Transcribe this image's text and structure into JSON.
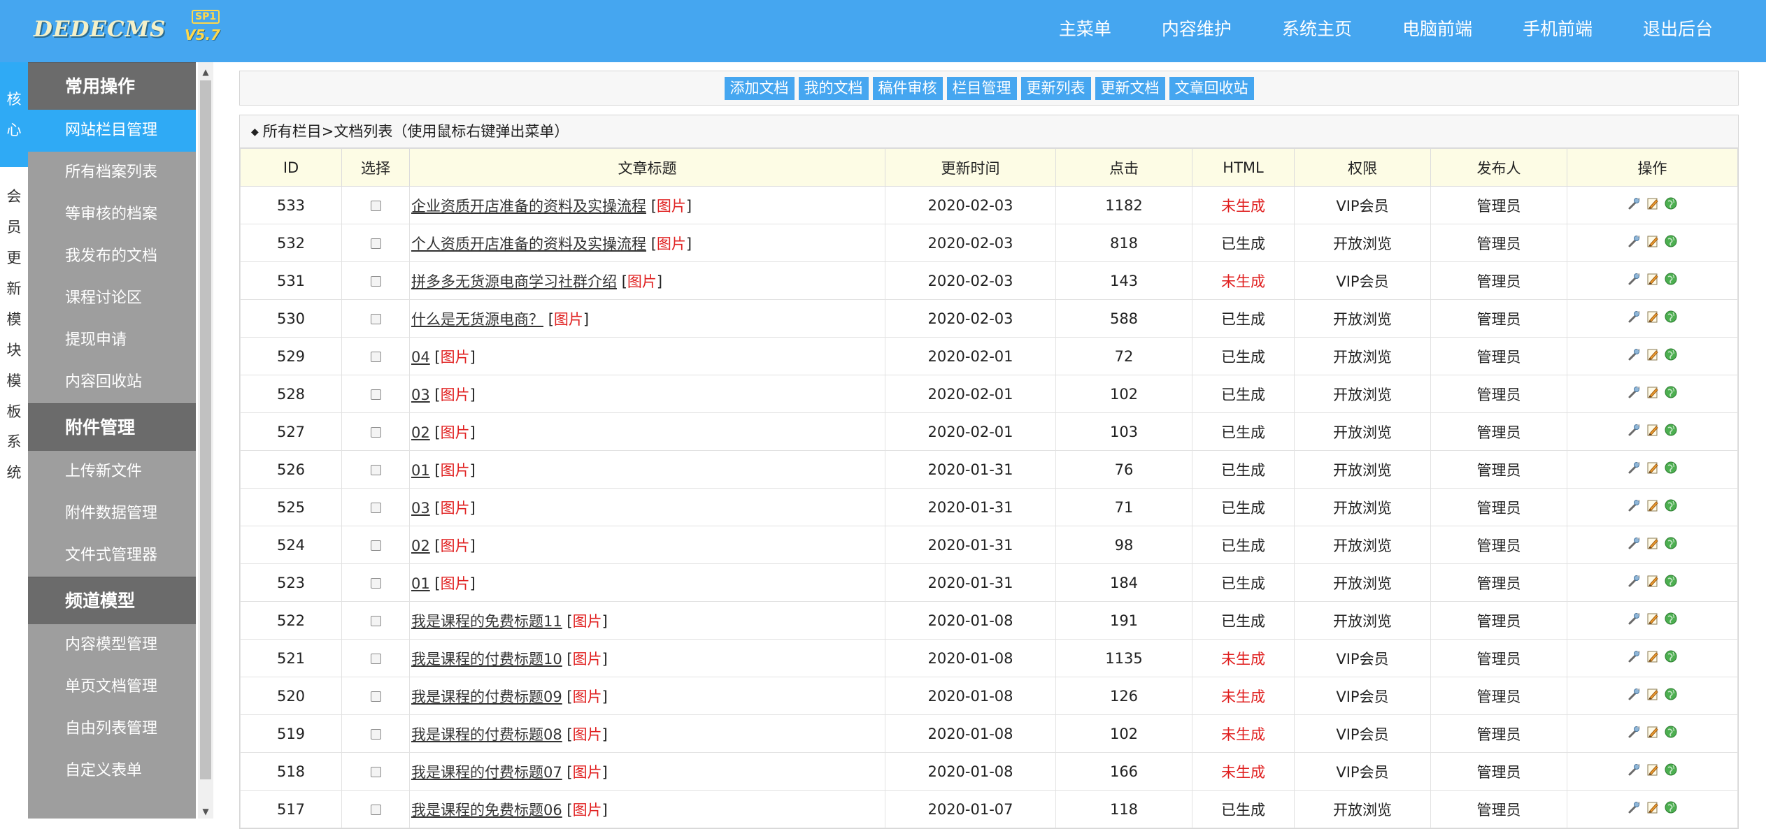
{
  "header": {
    "logo_text": "DEDECMS",
    "logo_tag": "SP1",
    "logo_version": "V5.7",
    "nav": [
      "主菜单",
      "内容维护",
      "系统主页",
      "电脑前端",
      "手机前端",
      "退出后台"
    ]
  },
  "vtabs": [
    {
      "label": "核心",
      "active": true
    },
    {
      "label": "会员",
      "active": false
    },
    {
      "label": "更新",
      "active": false
    },
    {
      "label": "模块",
      "active": false
    },
    {
      "label": "模板",
      "active": false
    },
    {
      "label": "系统",
      "active": false
    }
  ],
  "sidemenu": {
    "groups": [
      {
        "title": "常用操作",
        "items": [
          "网站栏目管理",
          "所有档案列表",
          "等审核的档案",
          "我发布的文档",
          "课程讨论区",
          "提现申请",
          "内容回收站"
        ]
      },
      {
        "title": "附件管理",
        "items": [
          "上传新文件",
          "附件数据管理",
          "文件式管理器"
        ]
      },
      {
        "title": "频道模型",
        "items": [
          "内容模型管理",
          "单页文档管理",
          "自由列表管理",
          "自定义表单"
        ]
      }
    ],
    "active_item": "网站栏目管理"
  },
  "toolbar": [
    "添加文档",
    "我的文档",
    "稿件审核",
    "栏目管理",
    "更新列表",
    "更新文档",
    "文章回收站"
  ],
  "breadcrumb": "所有栏目>文档列表（使用鼠标右键弹出菜单）",
  "table": {
    "columns": [
      "ID",
      "选择",
      "文章标题",
      "更新时间",
      "点击",
      "HTML",
      "权限",
      "发布人",
      "操作"
    ],
    "image_tag": "图片",
    "rows": [
      {
        "id": "533",
        "title": "企业资质开店准备的资料及实操流程",
        "date": "2020-02-03",
        "clicks": "1182",
        "html": "未生成",
        "perm": "VIP会员",
        "author": "管理员"
      },
      {
        "id": "532",
        "title": "个人资质开店准备的资料及实操流程",
        "date": "2020-02-03",
        "clicks": "818",
        "html": "已生成",
        "perm": "开放浏览",
        "author": "管理员"
      },
      {
        "id": "531",
        "title": "拼多多无货源电商学习社群介绍",
        "date": "2020-02-03",
        "clicks": "143",
        "html": "未生成",
        "perm": "VIP会员",
        "author": "管理员"
      },
      {
        "id": "530",
        "title": "什么是无货源电商？",
        "date": "2020-02-03",
        "clicks": "588",
        "html": "已生成",
        "perm": "开放浏览",
        "author": "管理员"
      },
      {
        "id": "529",
        "title": "04",
        "date": "2020-02-01",
        "clicks": "72",
        "html": "已生成",
        "perm": "开放浏览",
        "author": "管理员"
      },
      {
        "id": "528",
        "title": "03",
        "date": "2020-02-01",
        "clicks": "102",
        "html": "已生成",
        "perm": "开放浏览",
        "author": "管理员"
      },
      {
        "id": "527",
        "title": "02",
        "date": "2020-02-01",
        "clicks": "103",
        "html": "已生成",
        "perm": "开放浏览",
        "author": "管理员"
      },
      {
        "id": "526",
        "title": "01",
        "date": "2020-01-31",
        "clicks": "76",
        "html": "已生成",
        "perm": "开放浏览",
        "author": "管理员"
      },
      {
        "id": "525",
        "title": "03",
        "date": "2020-01-31",
        "clicks": "71",
        "html": "已生成",
        "perm": "开放浏览",
        "author": "管理员"
      },
      {
        "id": "524",
        "title": "02",
        "date": "2020-01-31",
        "clicks": "98",
        "html": "已生成",
        "perm": "开放浏览",
        "author": "管理员"
      },
      {
        "id": "523",
        "title": "01",
        "date": "2020-01-31",
        "clicks": "184",
        "html": "已生成",
        "perm": "开放浏览",
        "author": "管理员"
      },
      {
        "id": "522",
        "title": "我是课程的免费标题11",
        "date": "2020-01-08",
        "clicks": "191",
        "html": "已生成",
        "perm": "开放浏览",
        "author": "管理员"
      },
      {
        "id": "521",
        "title": "我是课程的付费标题10",
        "date": "2020-01-08",
        "clicks": "1135",
        "html": "未生成",
        "perm": "VIP会员",
        "author": "管理员"
      },
      {
        "id": "520",
        "title": "我是课程的付费标题09",
        "date": "2020-01-08",
        "clicks": "126",
        "html": "未生成",
        "perm": "VIP会员",
        "author": "管理员"
      },
      {
        "id": "519",
        "title": "我是课程的付费标题08",
        "date": "2020-01-08",
        "clicks": "102",
        "html": "未生成",
        "perm": "VIP会员",
        "author": "管理员"
      },
      {
        "id": "518",
        "title": "我是课程的付费标题07",
        "date": "2020-01-08",
        "clicks": "166",
        "html": "未生成",
        "perm": "VIP会员",
        "author": "管理员"
      },
      {
        "id": "517",
        "title": "我是课程的免费标题06",
        "date": "2020-01-07",
        "clicks": "118",
        "html": "已生成",
        "perm": "开放浏览",
        "author": "管理员"
      }
    ]
  },
  "colors": {
    "header_bg": "#45a6f0",
    "active_blue": "#2faaf5",
    "menu_bg": "#9e9e9e",
    "menu_head_bg": "#6b6b6b",
    "not_generated_red": "#e02020",
    "table_header_bg": "#fdfce5"
  },
  "icons": [
    "dedecms-logo",
    "checkbox-icon",
    "edit-wrench-icon",
    "edit-pencil-icon",
    "view-globe-icon",
    "scroll-up-arrow",
    "scroll-down-arrow"
  ]
}
